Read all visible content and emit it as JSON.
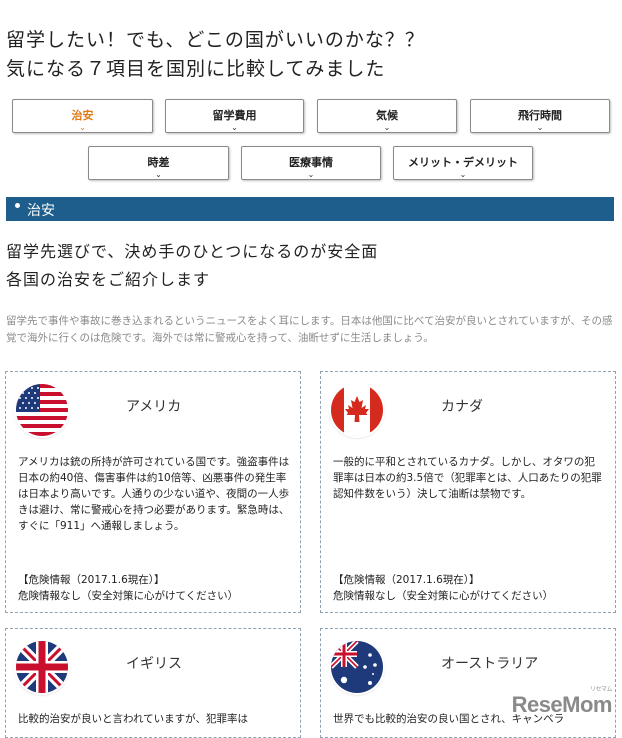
{
  "title": {
    "line1": "留学したい！でも、どこの国がいいのかな？？",
    "line2": "気になる７項目を国別に比較してみました"
  },
  "tabs": [
    {
      "label": "治安",
      "active": true
    },
    {
      "label": "留学費用"
    },
    {
      "label": "気候"
    },
    {
      "label": "飛行時間"
    },
    {
      "label": "時差"
    },
    {
      "label": "医療事情"
    },
    {
      "label": "メリット・デメリット"
    }
  ],
  "tab_chevron": "⌄",
  "section": {
    "header": "治安",
    "lead1": "留学先選びで、決め手のひとつになるのが安全面",
    "lead2": "各国の治安をご紹介します",
    "intro": "留学先で事件や事故に巻き込まれるというニュースをよく耳にします。日本は他国に比べて治安が良いとされていますが、その感覚で海外に行くのは危険です。海外では常に警戒心を持って、油断せずに生活しましょう。"
  },
  "countries": [
    {
      "name": "アメリカ",
      "flag": "us-flag-icon",
      "body": "アメリカは銃の所持が許可されている国です。強盗事件は日本の約40倍、傷害事件は約10倍等、凶悪事件の発生率は日本より高いです。人通りの少ない道や、夜間の一人歩きは避け、常に警戒心を持つ必要があります。緊急時は、すぐに「911」へ通報しましょう。",
      "risk_label": "【危険情報（2017.1.6現在）】",
      "risk_value": "危険情報なし（安全対策に心がけてください）"
    },
    {
      "name": "カナダ",
      "flag": "canada-flag-icon",
      "body": "一般的に平和とされているカナダ。しかし、オタワの犯罪率は日本の約3.5倍で（犯罪率とは、人口あたりの犯罪認知件数をいう）決して油断は禁物です。",
      "risk_label": "【危険情報（2017.1.6現在）】",
      "risk_value": "危険情報なし（安全対策に心がけてください）"
    },
    {
      "name": "イギリス",
      "flag": "uk-flag-icon",
      "body": "比較的治安が良いと言われていますが、犯罪率は"
    },
    {
      "name": "オーストラリア",
      "flag": "australia-flag-icon",
      "body": "世界でも比較的治安の良い国とされ、キャンベラ"
    }
  ],
  "watermark": {
    "text": "ReseMom",
    "sup": "リセマム"
  }
}
